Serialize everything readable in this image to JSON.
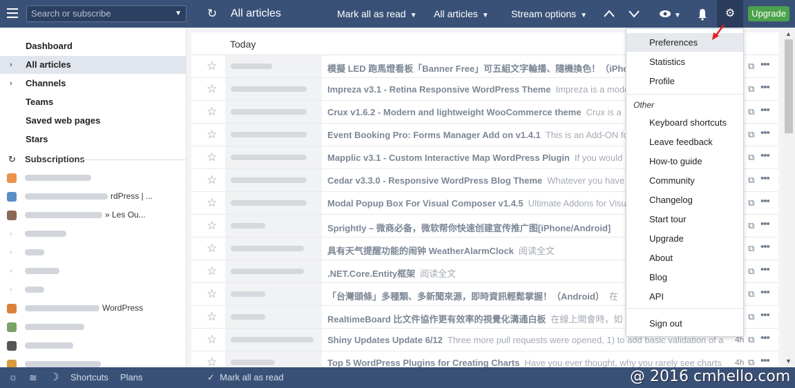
{
  "topbar": {
    "search_placeholder": "Search or subscribe",
    "refresh_icon": "refresh-icon",
    "title": "All articles",
    "mark_all_read": "Mark all as read",
    "filter": "All articles",
    "stream_options": "Stream options",
    "upgrade": "Upgrade"
  },
  "sidebar": {
    "nav": [
      {
        "label": "Dashboard",
        "arrow": ""
      },
      {
        "label": "All articles",
        "arrow": "›"
      },
      {
        "label": "Channels",
        "arrow": "›"
      },
      {
        "label": "Teams",
        "arrow": ""
      },
      {
        "label": "Saved web pages",
        "arrow": ""
      },
      {
        "label": "Stars",
        "arrow": ""
      }
    ],
    "subscriptions_label": "Subscriptions",
    "feeds": [
      {
        "text": "",
        "fav": "#e8934a",
        "blur": 96
      },
      {
        "text": "rdPress | ...",
        "fav": "#5a8ec4",
        "blur": 120
      },
      {
        "text": "» Les Ou...",
        "fav": "#8b6a55",
        "blur": 112
      },
      {
        "text": "",
        "fav": "",
        "blur": 60
      },
      {
        "text": "",
        "fav": "",
        "blur": 28
      },
      {
        "text": "",
        "fav": "",
        "blur": 50
      },
      {
        "text": "",
        "fav": "",
        "blur": 28
      },
      {
        "text": "WordPress",
        "fav": "#d9813b",
        "blur": 108
      },
      {
        "text": "",
        "fav": "#7aa36a",
        "blur": 86
      },
      {
        "text": "",
        "fav": "#555555",
        "blur": 70
      },
      {
        "text": "",
        "fav": "#d99b3b",
        "blur": 110
      }
    ]
  },
  "list": {
    "today": "Today",
    "rows": [
      {
        "title": "模擬 LED 跑馬燈看板「Banner Free」可五組文字輪播、隨機換色！（iPhone",
        "snippet": "",
        "age": "",
        "src": 60
      },
      {
        "title": "Impreza v3.1 - Retina Responsive WordPress Theme",
        "snippet": "Impreza is a modern",
        "age": "",
        "src": 110
      },
      {
        "title": "Crux v1.6.2 - Modern and lightweight WooCommerce theme",
        "snippet": "Crux is a",
        "age": "",
        "src": 110
      },
      {
        "title": "Event Booking Pro: Forms Manager Add on v1.4.1",
        "snippet": "This is an Add-ON for",
        "age": "",
        "src": 110
      },
      {
        "title": "Mapplic v3.1 - Custom Interactive Map WordPress Plugin",
        "snippet": "If you would",
        "age": "",
        "src": 110
      },
      {
        "title": "Cedar v3.3.0 - Responsive WordPress Blog Theme",
        "snippet": "Whatever you have",
        "age": "",
        "src": 110
      },
      {
        "title": "Modal Popup Box For Visual Composer v1.4.5",
        "snippet": "Ultimate Addons for Visual",
        "age": "",
        "src": 110
      },
      {
        "title": "Sprightly – 微商必备，微软帮你快速创建宣传推广图[iPhone/Android]",
        "snippet": "",
        "age": "",
        "src": 50
      },
      {
        "title": "具有天气提醒功能的闹钟 WeatherAlarmClock",
        "snippet": "阅读全文",
        "age": "",
        "src": 106
      },
      {
        "title": ".NET.Core.Entity框架",
        "snippet": "阅读全文",
        "age": "",
        "src": 106
      },
      {
        "title": "「台灣頭條」多種類、多新聞來源，即時資訊輕鬆掌握！（Android）",
        "snippet": "在",
        "age": "",
        "src": 50
      },
      {
        "title": "RealtimeBoard 比文件協作更有效率的視覺化溝通白板",
        "snippet": "在線上開會時，如",
        "age": "",
        "src": 50
      },
      {
        "title": "Shiny Updates Update 6/12",
        "snippet": "Three more pull requests were opened, 1) to add basic validation of a",
        "age": "4h",
        "src": 120
      },
      {
        "title": "Top 5 WordPress Plugins for Creating Charts",
        "snippet": "Have you ever thought, why you rarely see charts",
        "age": "4h",
        "src": 64
      }
    ]
  },
  "menu": {
    "top": [
      "Preferences",
      "Statistics",
      "Profile"
    ],
    "section": "Other",
    "items": [
      "Keyboard shortcuts",
      "Leave feedback",
      "How-to guide",
      "Community",
      "Changelog",
      "Start tour",
      "Upgrade",
      "About",
      "Blog",
      "API"
    ],
    "signout": "Sign out"
  },
  "bottombar": {
    "shortcuts": "Shortcuts",
    "plans": "Plans",
    "mark_all_read": "Mark all as read"
  },
  "watermark": "@ 2016 cmhello.com",
  "colors": {
    "topbar": "#3a5177",
    "upgrade": "#4ba34b",
    "arrow": "#e02020"
  }
}
